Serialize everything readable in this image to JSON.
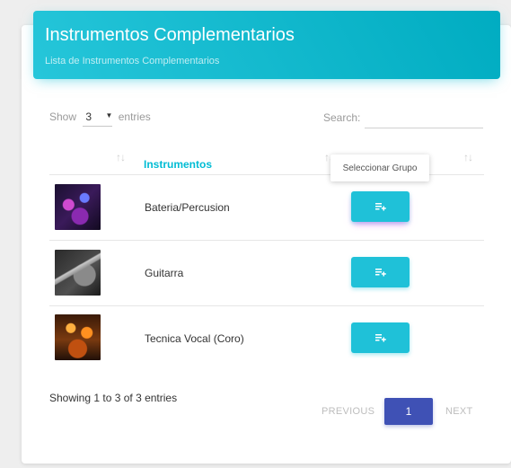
{
  "card": {
    "title": "Instrumentos Complementarios",
    "subtitle": "Lista de Instrumentos Complementarios"
  },
  "length_control": {
    "prefix": "Show",
    "selected": "3",
    "suffix": "entries"
  },
  "search": {
    "label": "Search:",
    "value": ""
  },
  "table": {
    "columns": [
      "",
      "Instrumentos",
      ""
    ],
    "rows": [
      {
        "name": "Bateria/Percusion"
      },
      {
        "name": "Guitarra"
      },
      {
        "name": "Tecnica Vocal (Coro)"
      }
    ]
  },
  "tooltip": {
    "text": "Seleccionar Grupo"
  },
  "footer": {
    "info": "Showing 1 to 3 of 3 entries",
    "previous": "PREVIOUS",
    "current_page": "1",
    "next": "NEXT"
  },
  "colors": {
    "header": "#00bcd4",
    "action_button": "#1fc1d8",
    "page_active": "#3f51b5"
  }
}
